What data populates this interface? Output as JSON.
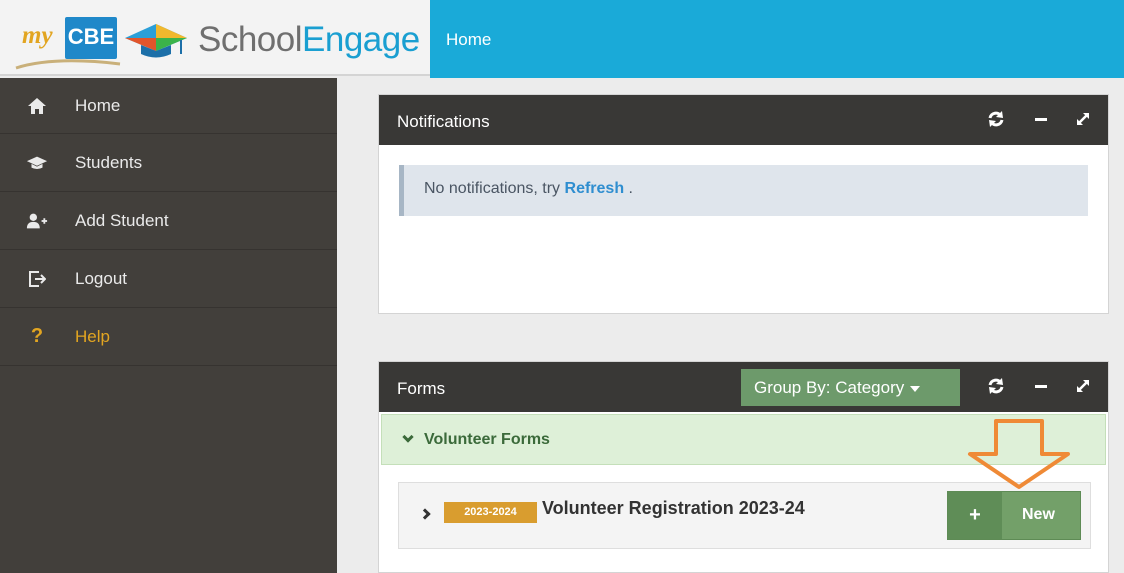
{
  "header": {
    "logo_my": "my",
    "logo_cbe": "CBE",
    "logo_school": "School",
    "logo_engage": "Engage",
    "page_title": "Home",
    "brand_color": "#1aaad8"
  },
  "sidebar": {
    "items": [
      {
        "label": "Home",
        "icon": "home-icon"
      },
      {
        "label": "Students",
        "icon": "graduation-cap-icon"
      },
      {
        "label": "Add Student",
        "icon": "add-user-icon"
      },
      {
        "label": "Logout",
        "icon": "logout-icon"
      },
      {
        "label": "Help",
        "icon": "help-icon"
      }
    ]
  },
  "notifications": {
    "title": "Notifications",
    "message_prefix": "No notifications, try",
    "refresh_link": "Refresh",
    "message_suffix": "."
  },
  "forms": {
    "title": "Forms",
    "group_by_label": "Group By: Category",
    "group_name": "Volunteer Forms",
    "rows": [
      {
        "year_badge": "2023-2024",
        "title": "Volunteer Registration 2023-24",
        "button_label": "New"
      }
    ]
  },
  "colors": {
    "sidebar_bg": "#423f3b",
    "panel_header": "#393836",
    "accent_green": "#6d9a6b",
    "badge_orange": "#d99d2f",
    "help_yellow": "#e2a521",
    "annotation_arrow": "#ef8a36"
  }
}
